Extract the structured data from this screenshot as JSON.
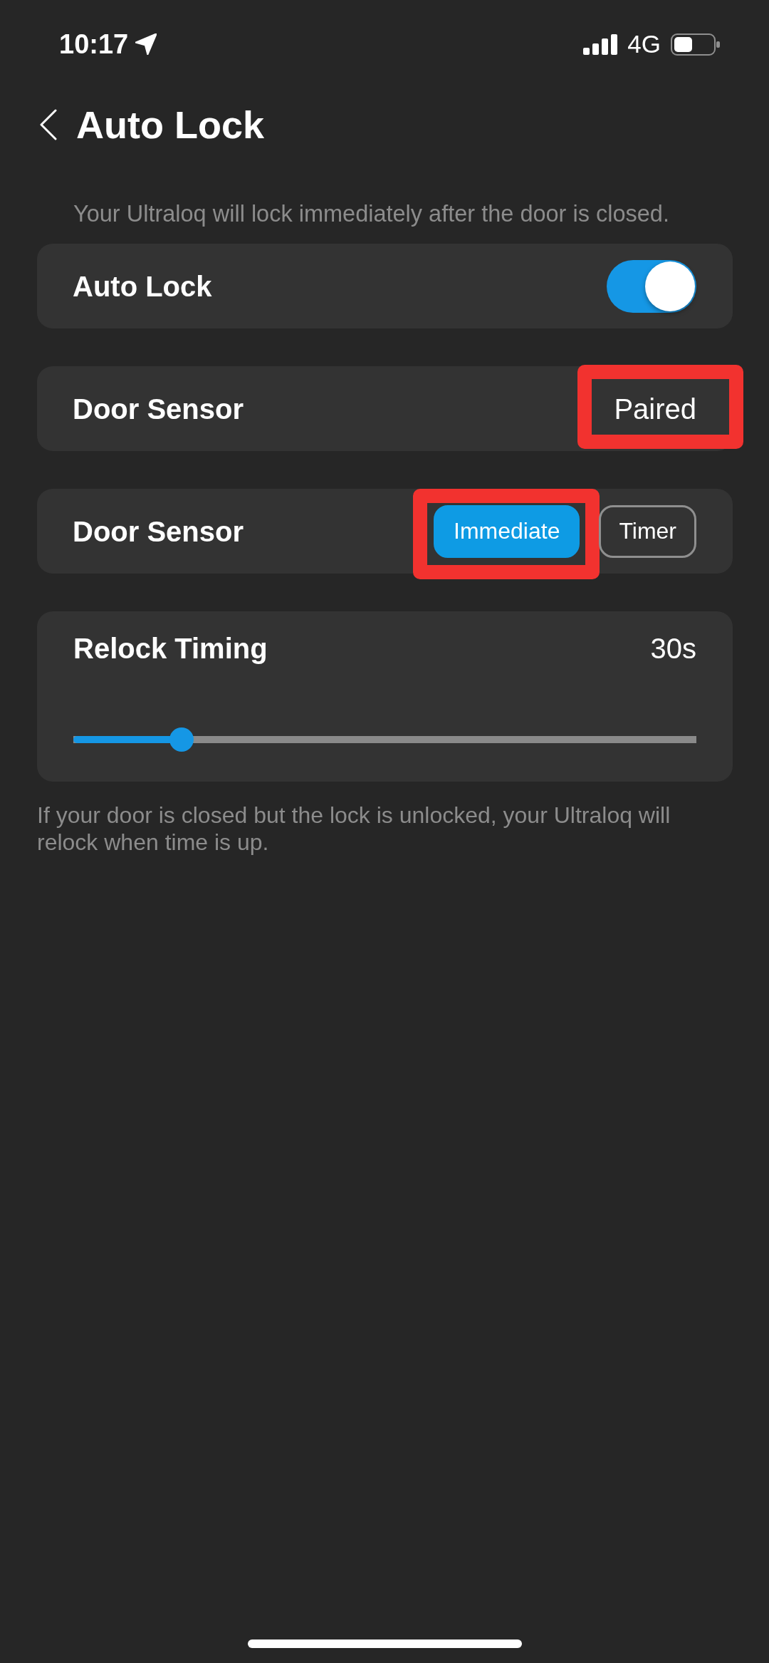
{
  "status_bar": {
    "time": "10:17",
    "network": "4G"
  },
  "header": {
    "title": "Auto Lock"
  },
  "description": "Your Ultraloq will lock immediately after the door is closed.",
  "rows": [
    {
      "kind": "toggle",
      "label": "Auto Lock",
      "on": true,
      "highlighted": false
    },
    {
      "kind": "status",
      "label": "Door Sensor",
      "value": "Paired",
      "highlighted": true
    },
    {
      "kind": "segmented",
      "label": "Door Sensor",
      "highlighted": false,
      "options": [
        {
          "label": "Immediate",
          "selected": true,
          "highlighted": true
        },
        {
          "label": "Timer",
          "selected": false,
          "highlighted": false
        }
      ]
    },
    {
      "kind": "slider",
      "label": "Relock Timing",
      "value": "30s",
      "level": 0.174,
      "highlighted": false
    }
  ],
  "footnote": "If your door is closed but the lock is unlocked, your Ultraloq will relock when time is up."
}
